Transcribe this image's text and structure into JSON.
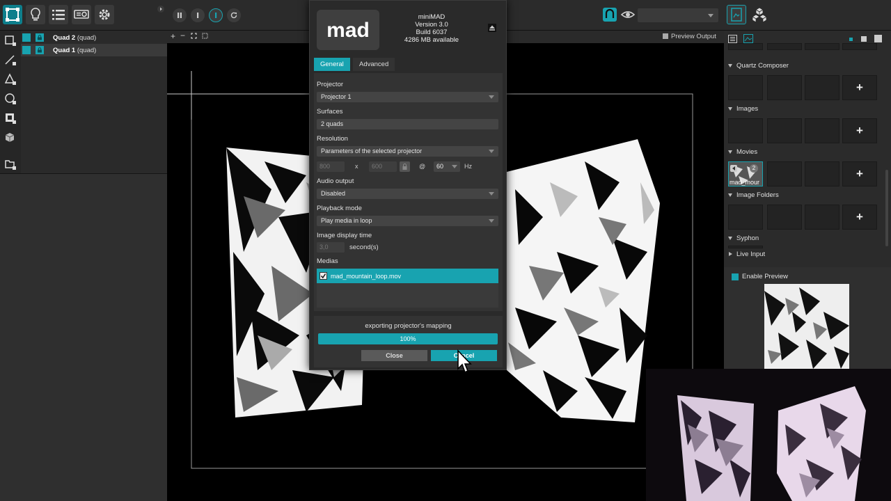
{
  "toolbar": {
    "preview_output_label": "Preview Output"
  },
  "surfaces": [
    {
      "name": "Quad 2",
      "type": "(quad)"
    },
    {
      "name": "Quad 1",
      "type": "(quad)"
    }
  ],
  "dialog": {
    "logo_text": "mad",
    "app_name": "miniMAD",
    "version": "Version 3.0",
    "build": "Build 6037",
    "memory": "4286 MB available",
    "tabs": [
      "General",
      "Advanced"
    ],
    "projector_label": "Projector",
    "projector_value": "Projector 1",
    "surfaces_label": "Surfaces",
    "surfaces_value": "2 quads",
    "resolution_label": "Resolution",
    "resolution_value": "Parameters of the selected projector",
    "res_width": "800",
    "res_x": "x",
    "res_height": "600",
    "res_at": "@",
    "res_rate": "60",
    "res_unit": "Hz",
    "audio_label": "Audio output",
    "audio_value": "Disabled",
    "playback_label": "Playback mode",
    "playback_value": "Play media in loop",
    "image_time_label": "Image display time",
    "image_time_value": "3,0",
    "image_time_unit": "second(s)",
    "medias_label": "Medias",
    "media_file": "mad_mountain_loop.mov",
    "export_status": "exporting projector's mapping",
    "progress_text": "100%",
    "progress": 1.0,
    "close_label": "Close",
    "cancel_label": "Cancel"
  },
  "media_panel": {
    "sections": [
      "Quartz Composer",
      "Images",
      "Movies",
      "Image Folders",
      "Syphon",
      "Live Input"
    ],
    "plus_label": "+",
    "movie_thumb_label": "mad_mour",
    "movie_badge": "2",
    "enable_preview_label": "Enable Preview"
  },
  "colors": {
    "accent": "#18a3b0",
    "panel": "#2b2b2b",
    "canvas": "#000000"
  }
}
